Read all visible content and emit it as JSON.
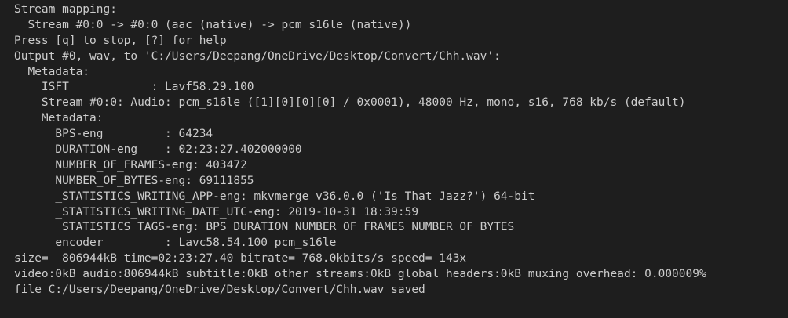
{
  "terminal": {
    "lines": [
      "Stream mapping:",
      "  Stream #0:0 -> #0:0 (aac (native) -> pcm_s16le (native))",
      "Press [q] to stop, [?] for help",
      "Output #0, wav, to 'C:/Users/Deepang/OneDrive/Desktop/Convert/Chh.wav':",
      "  Metadata:",
      "    ISFT            : Lavf58.29.100",
      "    Stream #0:0: Audio: pcm_s16le ([1][0][0][0] / 0x0001), 48000 Hz, mono, s16, 768 kb/s (default)",
      "    Metadata:",
      "      BPS-eng         : 64234",
      "      DURATION-eng    : 02:23:27.402000000",
      "      NUMBER_OF_FRAMES-eng: 403472",
      "      NUMBER_OF_BYTES-eng: 69111855",
      "      _STATISTICS_WRITING_APP-eng: mkvmerge v36.0.0 ('Is That Jazz?') 64-bit",
      "      _STATISTICS_WRITING_DATE_UTC-eng: 2019-10-31 18:39:59",
      "      _STATISTICS_TAGS-eng: BPS DURATION NUMBER_OF_FRAMES NUMBER_OF_BYTES",
      "      encoder         : Lavc58.54.100 pcm_s16le",
      "size=  806944kB time=02:23:27.40 bitrate= 768.0kbits/s speed= 143x",
      "video:0kB audio:806944kB subtitle:0kB other streams:0kB global headers:0kB muxing overhead: 0.000009%",
      "file C:/Users/Deepang/OneDrive/Desktop/Convert/Chh.wav saved"
    ]
  }
}
